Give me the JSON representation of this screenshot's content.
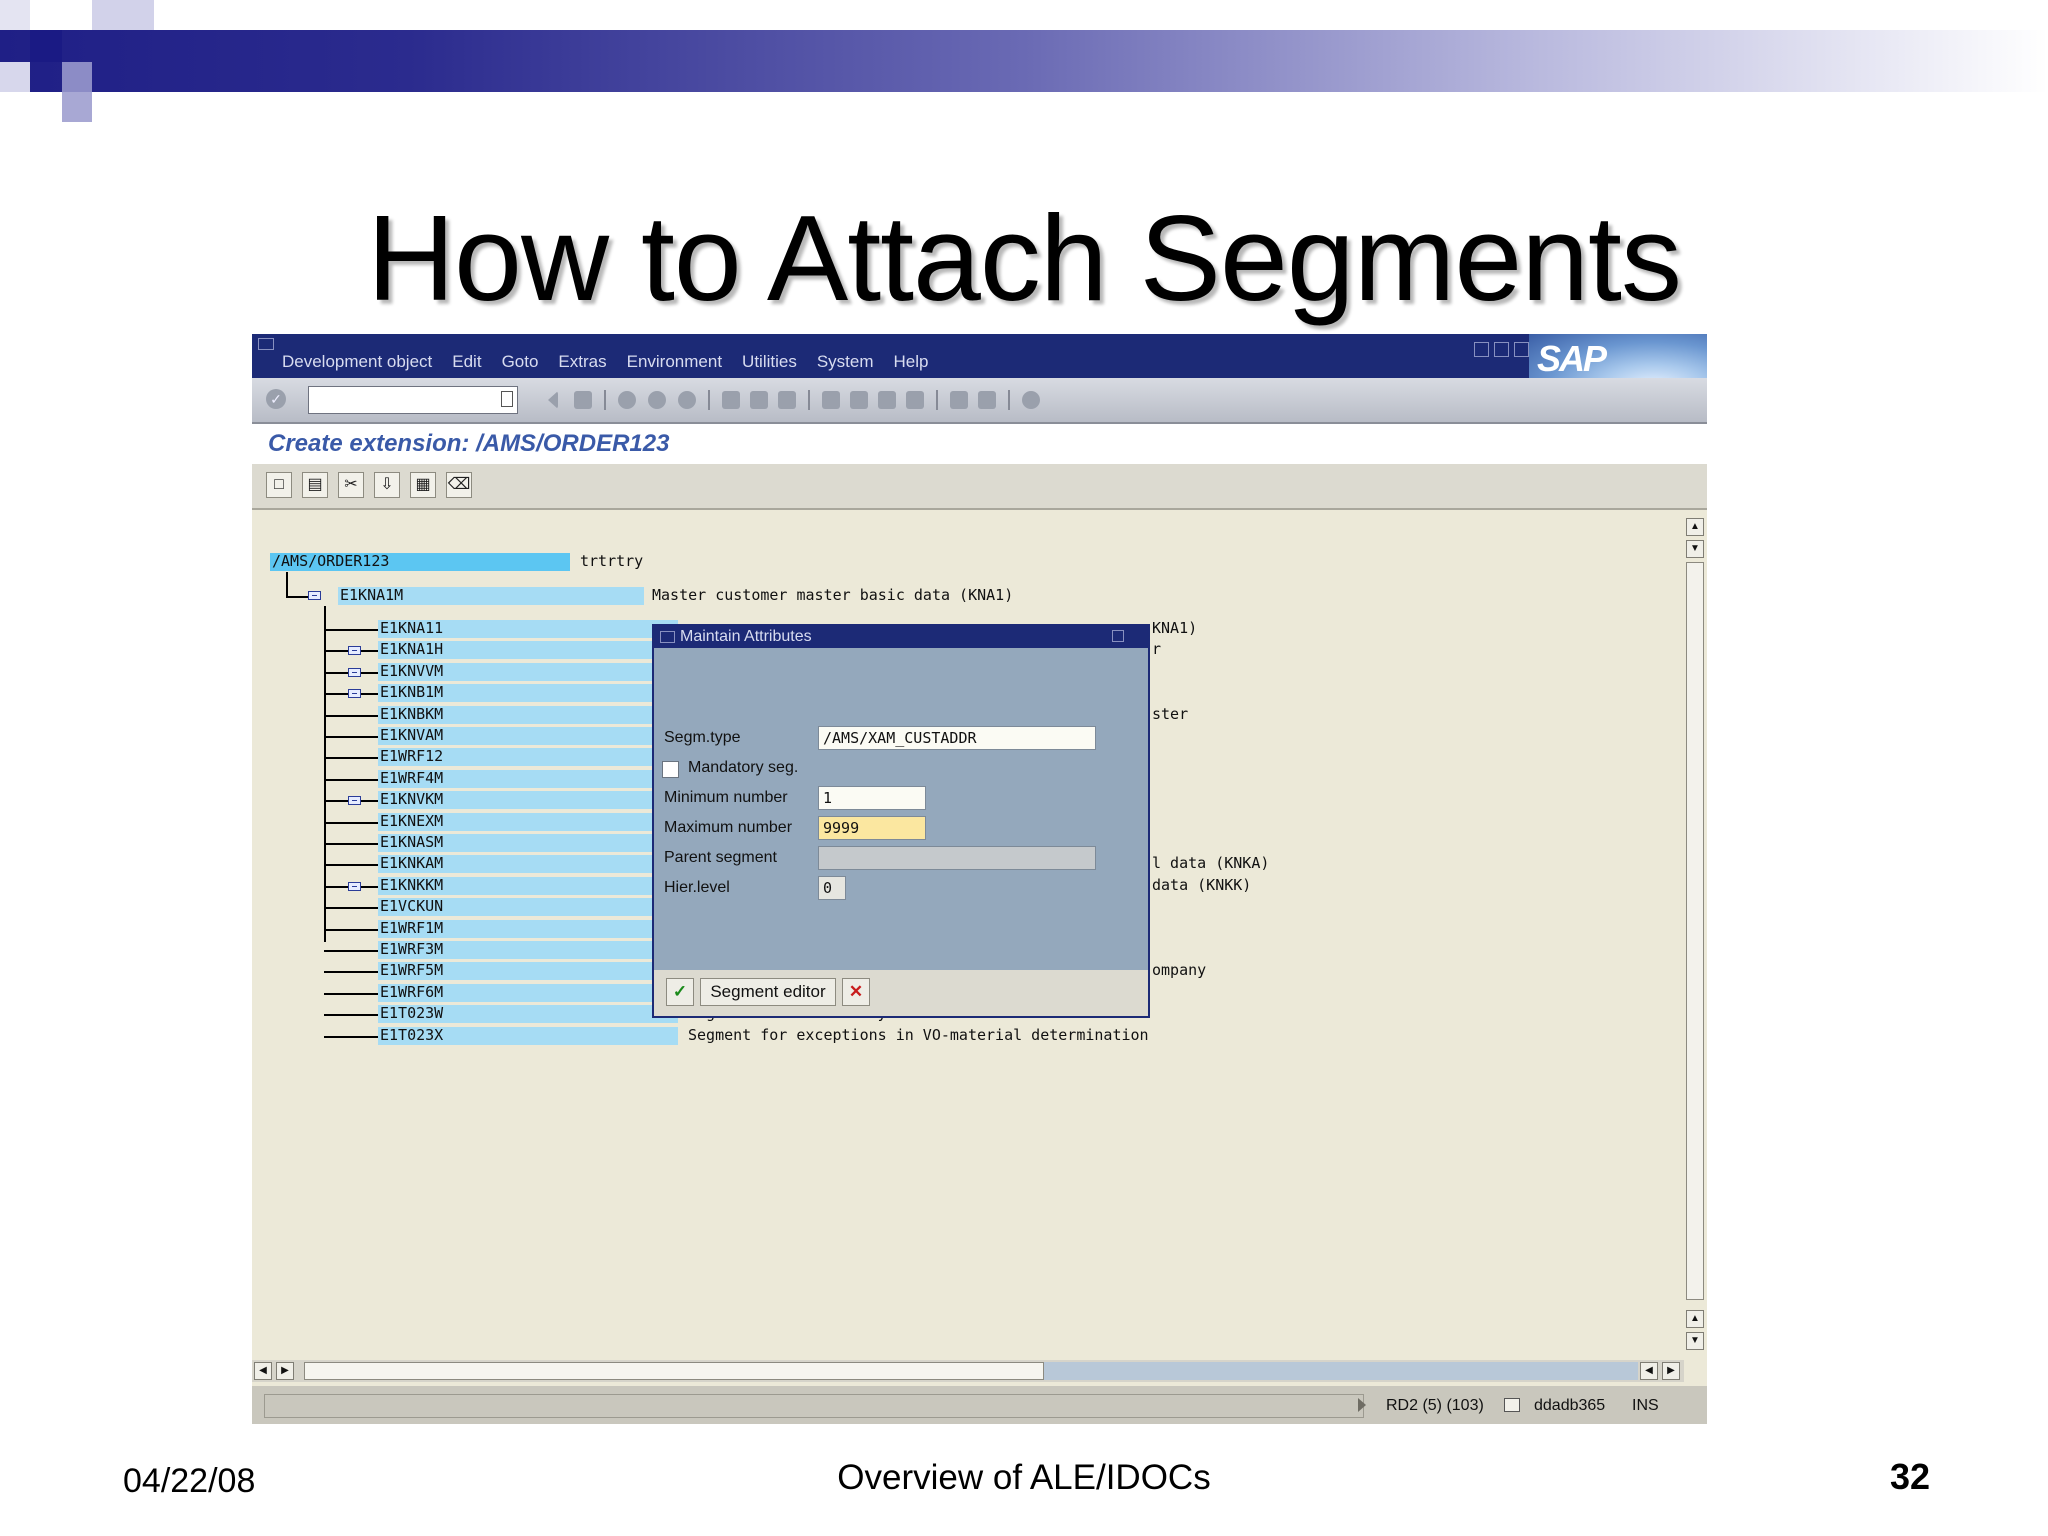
{
  "slide": {
    "title": "How to Attach Segments",
    "date": "04/22/08",
    "footer": "Overview of ALE/IDOCs",
    "page": "32"
  },
  "colors": {
    "header_blue": "#1f1f86",
    "tree_highlight": "#a6dcf4",
    "dialog_bg": "#94a8bc",
    "titlebar": "#1c2a76",
    "screen_title": "#3a5aa8"
  },
  "sap": {
    "logo": "SAP",
    "menu": [
      "Development object",
      "Edit",
      "Goto",
      "Extras",
      "Environment",
      "Utilities",
      "System",
      "Help"
    ],
    "screen_title": "Create extension: /AMS/ORDER123",
    "tree": {
      "root": {
        "name": "/AMS/ORDER123",
        "desc": "trtrtry"
      },
      "level1": {
        "name": "E1KNA1M",
        "desc": "Master customer master basic data (KNA1)"
      },
      "children": [
        {
          "name": "E1KNA11",
          "desc": "KNA1)",
          "expandable": false
        },
        {
          "name": "E1KNA1H",
          "desc": "r",
          "expandable": true
        },
        {
          "name": "E1KNVVM",
          "desc": "",
          "expandable": true
        },
        {
          "name": "E1KNB1M",
          "desc": "",
          "expandable": true
        },
        {
          "name": "E1KNBKM",
          "desc": "ster",
          "expandable": false
        },
        {
          "name": "E1KNVAM",
          "desc": "",
          "expandable": false
        },
        {
          "name": "E1WRF12",
          "desc": "",
          "expandable": false
        },
        {
          "name": "E1WRF4M",
          "desc": "",
          "expandable": false
        },
        {
          "name": "E1KNVKM",
          "desc": "",
          "expandable": true
        },
        {
          "name": "E1KNEXM",
          "desc": "",
          "expandable": false
        },
        {
          "name": "E1KNASM",
          "desc": "",
          "expandable": false
        },
        {
          "name": "E1KNKAM",
          "desc": "l data (KNKA)",
          "expandable": false
        },
        {
          "name": "E1KNKKM",
          "desc": "data (KNKK)",
          "expandable": true
        },
        {
          "name": "E1VCKUN",
          "desc": "",
          "expandable": false
        },
        {
          "name": "E1WRF1M",
          "desc": "",
          "expandable": false
        },
        {
          "name": "E1WRF3M",
          "desc": "",
          "expandable": false
        },
        {
          "name": "E1WRF5M",
          "desc": "ompany",
          "expandable": false
        },
        {
          "name": "E1WRF6M",
          "desc": "",
          "expandable": false
        },
        {
          "name": "E1T023W",
          "desc": "Segment for value-only material determination",
          "expandable": false
        },
        {
          "name": "E1T023X",
          "desc": "Segment for exceptions in VO-material determination",
          "expandable": false
        }
      ]
    },
    "dialog": {
      "title": "Maintain Attributes",
      "segm_type_label": "Segm.type",
      "segm_type_value": "/AMS/XAM_CUSTADDR",
      "mandatory_label": "Mandatory seg.",
      "mandatory_checked": false,
      "min_label": "Minimum number",
      "min_value": "1",
      "max_label": "Maximum number",
      "max_value": "9999",
      "parent_label": "Parent segment",
      "parent_value": "",
      "hier_label": "Hier.level",
      "hier_value": "0",
      "segment_editor_label": "Segment editor"
    },
    "status": {
      "system": "RD2 (5) (103)",
      "host": "ddadb365",
      "mode": "INS"
    }
  }
}
